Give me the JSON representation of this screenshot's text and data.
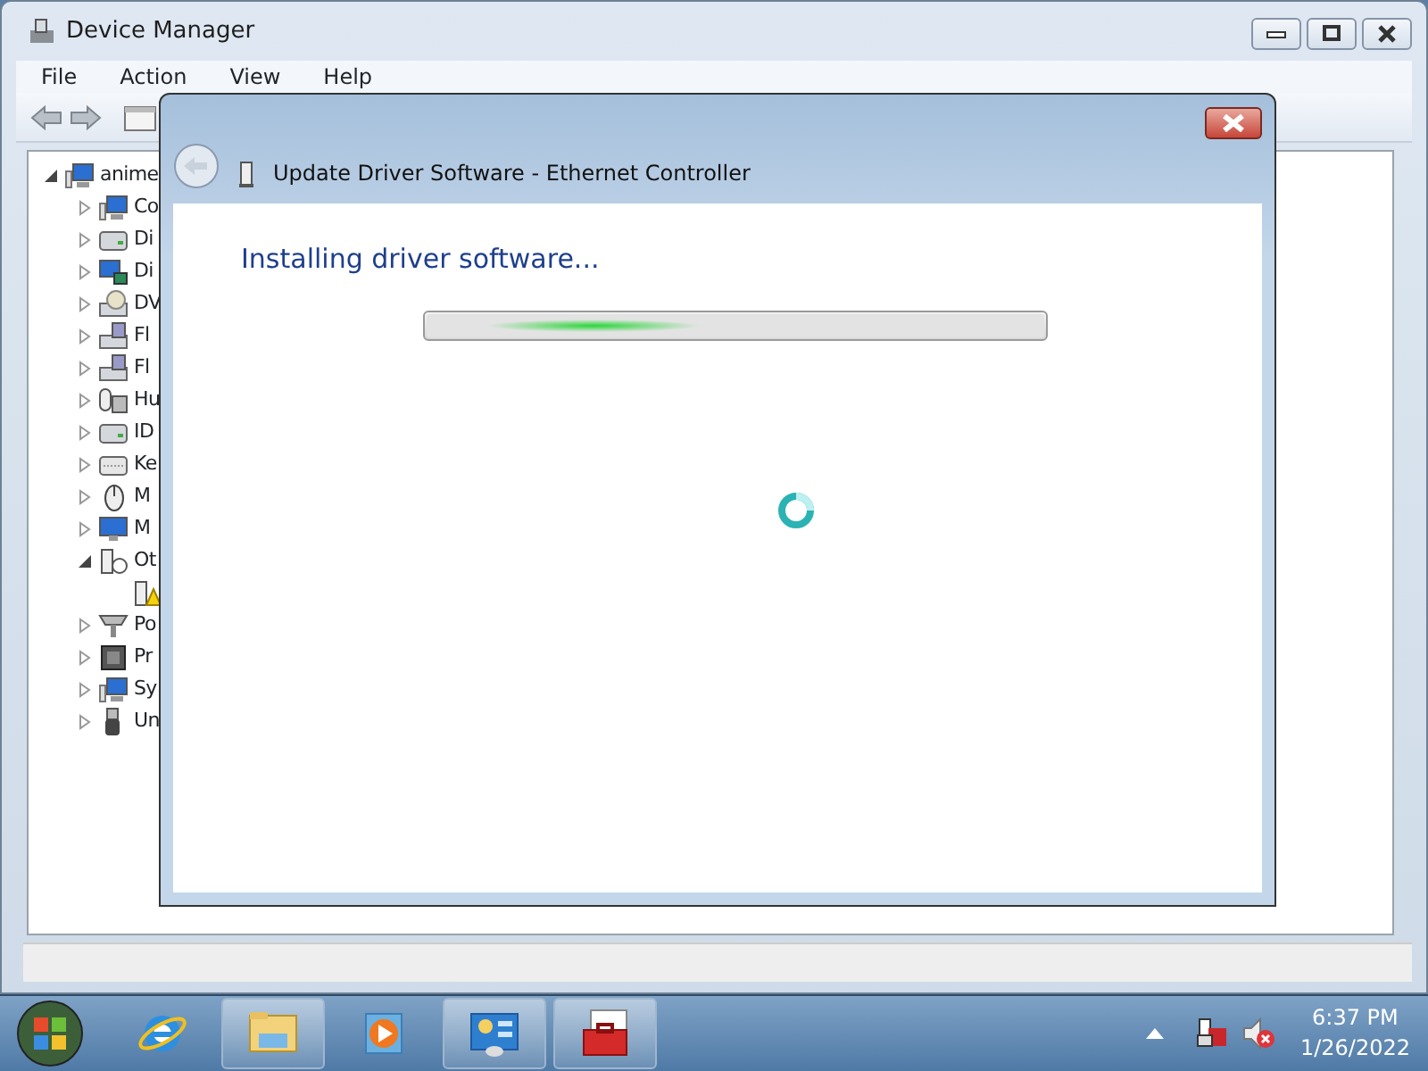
{
  "window": {
    "title": "Device Manager"
  },
  "menu": [
    "File",
    "Action",
    "View",
    "Help"
  ],
  "tree": {
    "label": "anime",
    "kind": "computer",
    "expanded": true,
    "children": [
      {
        "label": "Co",
        "kind": "computer",
        "expanded": false
      },
      {
        "label": "Di",
        "kind": "drive",
        "expanded": false
      },
      {
        "label": "Di",
        "kind": "display",
        "expanded": false
      },
      {
        "label": "DV",
        "kind": "dvd",
        "expanded": false
      },
      {
        "label": "Fl",
        "kind": "floppy",
        "expanded": false
      },
      {
        "label": "Fl",
        "kind": "floppy",
        "expanded": false
      },
      {
        "label": "Hu",
        "kind": "hid",
        "expanded": false
      },
      {
        "label": "ID",
        "kind": "drive",
        "expanded": false
      },
      {
        "label": "Ke",
        "kind": "keyboard",
        "expanded": false
      },
      {
        "label": "M",
        "kind": "mouse",
        "expanded": false
      },
      {
        "label": "M",
        "kind": "monitor",
        "expanded": false
      },
      {
        "label": "Ot",
        "kind": "other",
        "expanded": true,
        "children": [
          {
            "kind": "warning"
          }
        ]
      },
      {
        "label": "Po",
        "kind": "port",
        "expanded": false
      },
      {
        "label": "Pr",
        "kind": "processor",
        "expanded": false
      },
      {
        "label": "Sy",
        "kind": "computer",
        "expanded": false
      },
      {
        "label": "Un",
        "kind": "usb",
        "expanded": false
      }
    ]
  },
  "dialog": {
    "title": "Update Driver Software - Ethernet Controller",
    "heading": "Installing driver software...",
    "progress": {
      "marquee": true
    }
  },
  "taskbar": {
    "items": [
      {
        "kind": "ie",
        "running": false
      },
      {
        "kind": "explorer",
        "running": true
      },
      {
        "kind": "media",
        "running": false
      },
      {
        "kind": "control",
        "running": true
      },
      {
        "kind": "toolbox",
        "running": true
      }
    ],
    "clock": {
      "time": "6:37 PM",
      "date": "1/26/2022"
    }
  }
}
